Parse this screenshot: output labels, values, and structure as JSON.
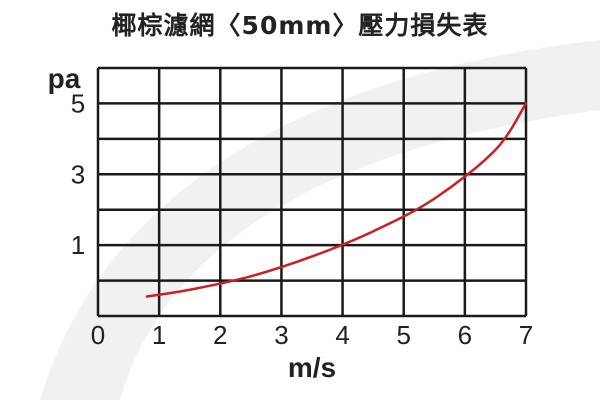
{
  "chart_data": {
    "type": "line",
    "title": "椰棕濾網〈50mm〉壓力損失表",
    "xlabel": "m/s",
    "ylabel": "pa",
    "x_ticks": [
      0,
      1,
      2,
      3,
      4,
      5,
      6,
      7
    ],
    "y_ticks": [
      1,
      3,
      5
    ],
    "xlim": [
      0,
      7
    ],
    "ylim": [
      -1,
      6
    ],
    "grid": true,
    "series": [
      {
        "color": "#cc1f1f",
        "x": [
          0.8,
          1.5,
          2.5,
          3.5,
          4.5,
          5.5,
          6.5,
          7.0
        ],
        "y": [
          -0.45,
          -0.26,
          0.12,
          0.68,
          1.39,
          2.31,
          3.69,
          5.0
        ]
      }
    ]
  },
  "colors": {
    "grid": "#1a1a1a",
    "text": "#222222",
    "curve": "#cc1f1f",
    "swoosh": "#f1f1f1"
  }
}
